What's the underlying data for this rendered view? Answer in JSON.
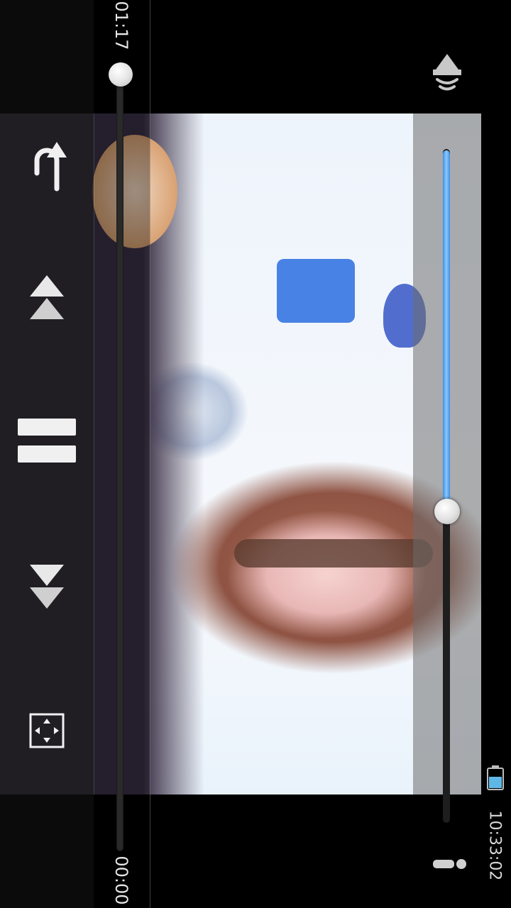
{
  "player": {
    "elapsed_time": "01:17",
    "total_time": "00:00",
    "seek_position": 0.0,
    "volume_level": 0.55,
    "accent_color": "#4a9be8"
  },
  "status_bar": {
    "clock": "10:33:02",
    "battery_icon": "battery-icon"
  },
  "controls": {
    "back_icon": "back-icon",
    "prev_icon": "previous-icon",
    "pause_icon": "pause-icon",
    "next_icon": "next-icon",
    "fullscreen_icon": "fullscreen-icon",
    "volume_icon": "volume-icon",
    "info_icon": "info-icon"
  }
}
